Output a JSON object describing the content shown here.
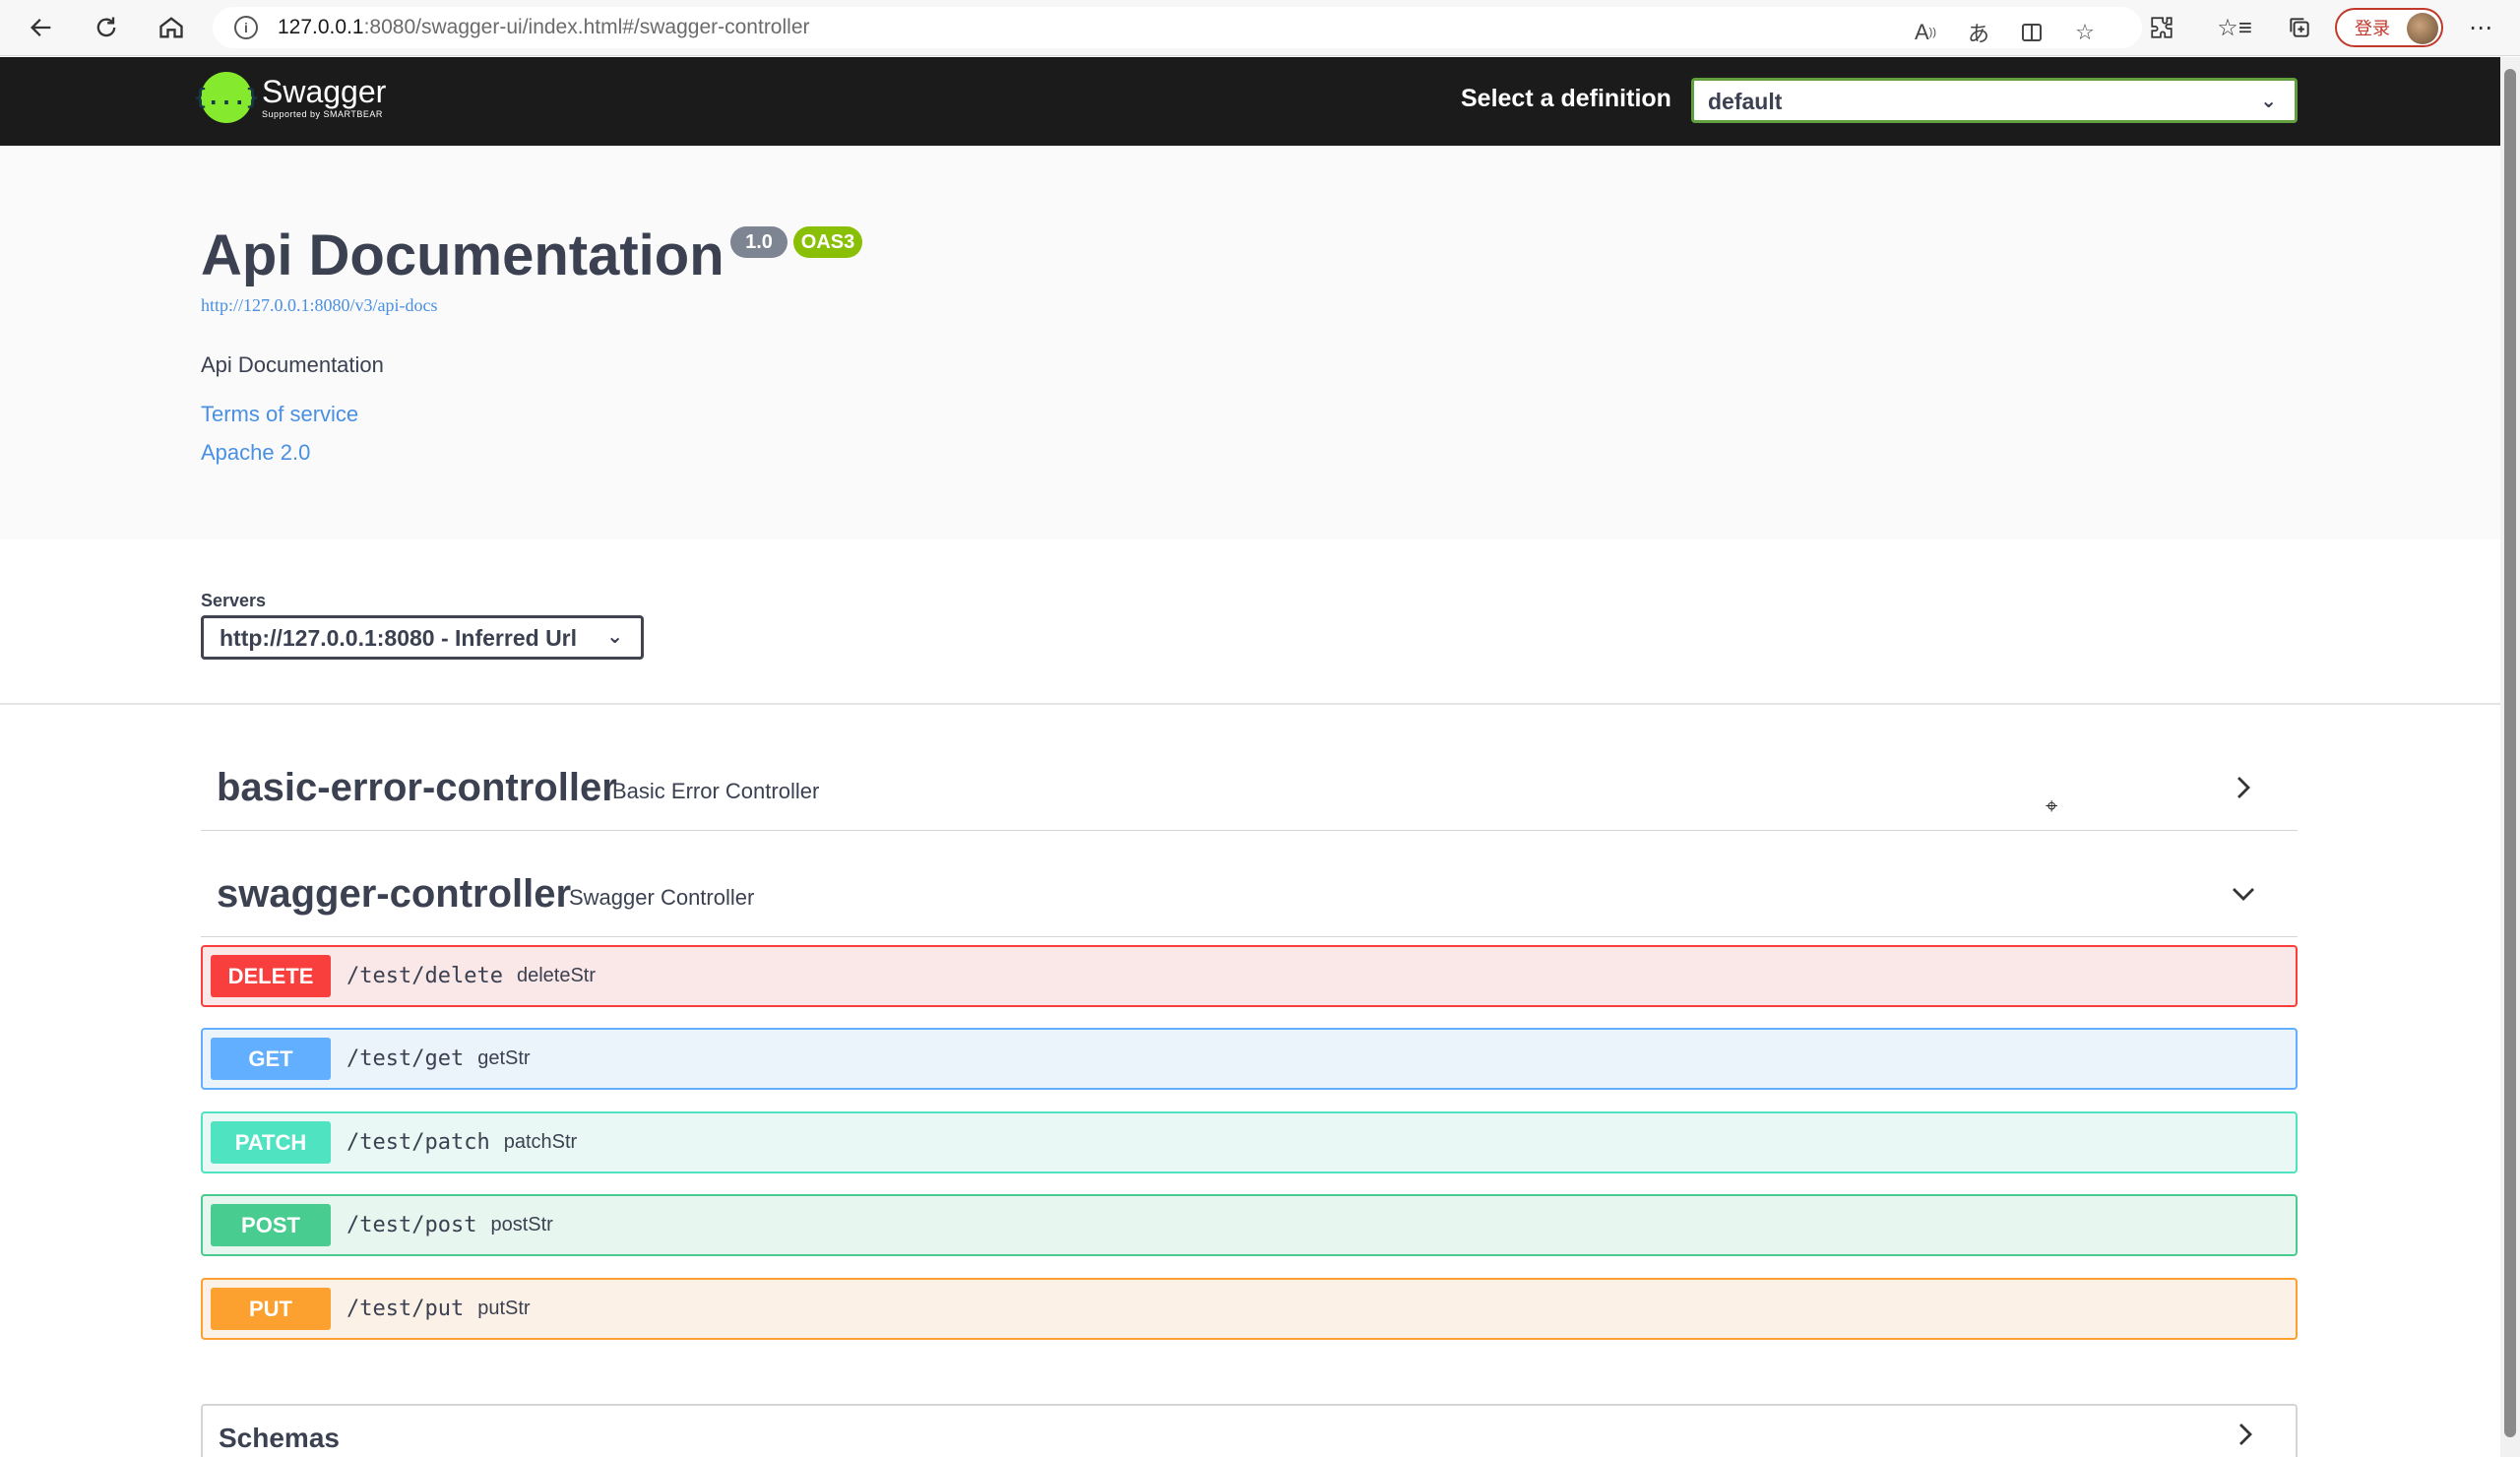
{
  "browser": {
    "url_host": "127.0.0.1",
    "url_rest": ":8080/swagger-ui/index.html#/swagger-controller",
    "login_label": "登录",
    "icons": [
      "back-icon",
      "refresh-icon",
      "home-icon",
      "info-icon",
      "read-aloud-icon",
      "translate-icon",
      "split-screen-icon",
      "favorite-add-icon",
      "extensions-icon",
      "favorites-icon",
      "collections-icon",
      "more-icon"
    ]
  },
  "topbar": {
    "logo_text": "Swagger",
    "logo_sub": "Supported by SMARTBEAR",
    "logo_glyph": "{...}",
    "definition_label": "Select a definition",
    "definition_value": "default",
    "accent": "#62a03f"
  },
  "info": {
    "title": "Api Documentation",
    "version": "1.0",
    "oas": "OAS3",
    "spec_url": "http://127.0.0.1:8080/v3/api-docs",
    "description": "Api Documentation",
    "terms": "Terms of service",
    "license": "Apache 2.0"
  },
  "servers": {
    "label": "Servers",
    "selected": "http://127.0.0.1:8080 - Inferred Url"
  },
  "tags": [
    {
      "name": "basic-error-controller",
      "description": "Basic Error Controller",
      "expanded": false
    },
    {
      "name": "swagger-controller",
      "description": "Swagger Controller",
      "expanded": true
    }
  ],
  "operations": [
    {
      "method": "DELETE",
      "path": "/test/delete",
      "summary": "deleteStr",
      "color": "#f93e3e",
      "bg": "#fae7e7"
    },
    {
      "method": "GET",
      "path": "/test/get",
      "summary": "getStr",
      "color": "#61affe",
      "bg": "#ebf3fb"
    },
    {
      "method": "PATCH",
      "path": "/test/patch",
      "summary": "patchStr",
      "color": "#50e3c2",
      "bg": "#e9f8f5"
    },
    {
      "method": "POST",
      "path": "/test/post",
      "summary": "postStr",
      "color": "#49cc90",
      "bg": "#e8f6f0"
    },
    {
      "method": "PUT",
      "path": "/test/put",
      "summary": "putStr",
      "color": "#fca130",
      "bg": "#fbf1e6"
    }
  ],
  "schemas": {
    "label": "Schemas"
  }
}
